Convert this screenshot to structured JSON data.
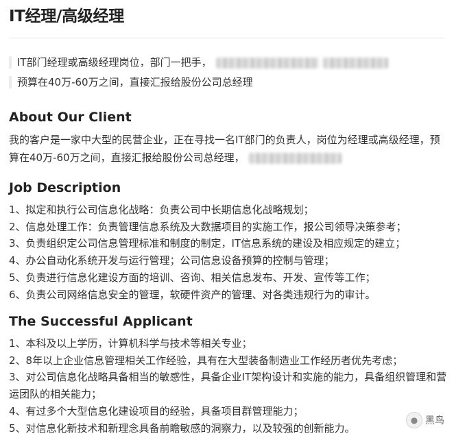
{
  "page": {
    "title": "IT经理/高级经理",
    "bullets": [
      {
        "text": "IT部门经理或高级经理岗位，部门一把手，",
        "has_redaction": true
      },
      {
        "text": "预算在40万-60万之间，直接汇报给股份公司总经理",
        "has_redaction": false
      }
    ]
  },
  "about": {
    "heading": "About Our Client",
    "text": "我的客户是一家中大型的民营企业，正在寻找一名IT部门的负责人，岗位为经理或高级经理，预算在40万-60万之间，直接汇报给股份公司总经理，"
  },
  "job": {
    "heading": "Job Description",
    "items": [
      "1、拟定和执行公司信息化战略：负责公司中长期信息化战略规划；",
      "2、信息处理工作：负责管理信息系统及大数据项目的实施工作，报公司领导决策参考；",
      "3、负责组织定公司信息管理标准和制度的制定，IT信息系统的建设及相应规定的建立；",
      "4、办公自动化系统开发与运行管理；公司信息设备预算的控制与管理；",
      "5、负责进行信息化建设方面的培训、咨询、相关信息发布、开发、宣传等工作；",
      "6、负责公司网络信息安全的管理，软硬件资产的管理、对各类违规行为的审计。"
    ]
  },
  "applicant": {
    "heading": "The Successful Applicant",
    "items": [
      "1、本科及以上学历，计算机科学与技术等相关专业；",
      "2、8年以上企业信息管理相关工作经验，具有在大型装备制造业工作经历者优先考虑；",
      "3、对公司信息化战略具备相当的敏感性，具备企业IT架构设计和实施的能力，具备组织管理和营运团队的相关能力；",
      "4、有过多个大型信息化建设项目的经验，具备项目群管理能力；",
      "5、对信息化新技术和新理念具备前瞻敏感的洞察力，以及较强的创新能力。"
    ]
  },
  "watermark": {
    "icon": "wechat-account-icon",
    "label": "黑鸟"
  },
  "colors": {
    "text": "#333333",
    "heading": "#222222",
    "rule": "#e6e6e6"
  }
}
